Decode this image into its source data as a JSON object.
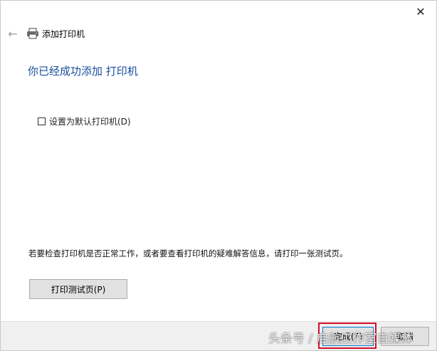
{
  "window": {
    "close_glyph": "✕"
  },
  "nav": {
    "back_glyph": "←",
    "title": "添加打印机"
  },
  "content": {
    "heading": "你已经成功添加 打印机",
    "default_checkbox_label": "设置为默认打印机(D)",
    "default_checked": false,
    "info_text": "若要检查打印机是否正常工作，或者要查看打印机的疑难解答信息，请打印一张测试页。",
    "test_page_button": "打印测试页(P)"
  },
  "footer": {
    "finish_button": "完成(F)",
    "cancel_button": "取消"
  },
  "watermark": "头条号 / 启航工作室自媒体",
  "colors": {
    "heading": "#1a4fa0",
    "highlight": "#d0102a",
    "focus": "#0078d7"
  }
}
